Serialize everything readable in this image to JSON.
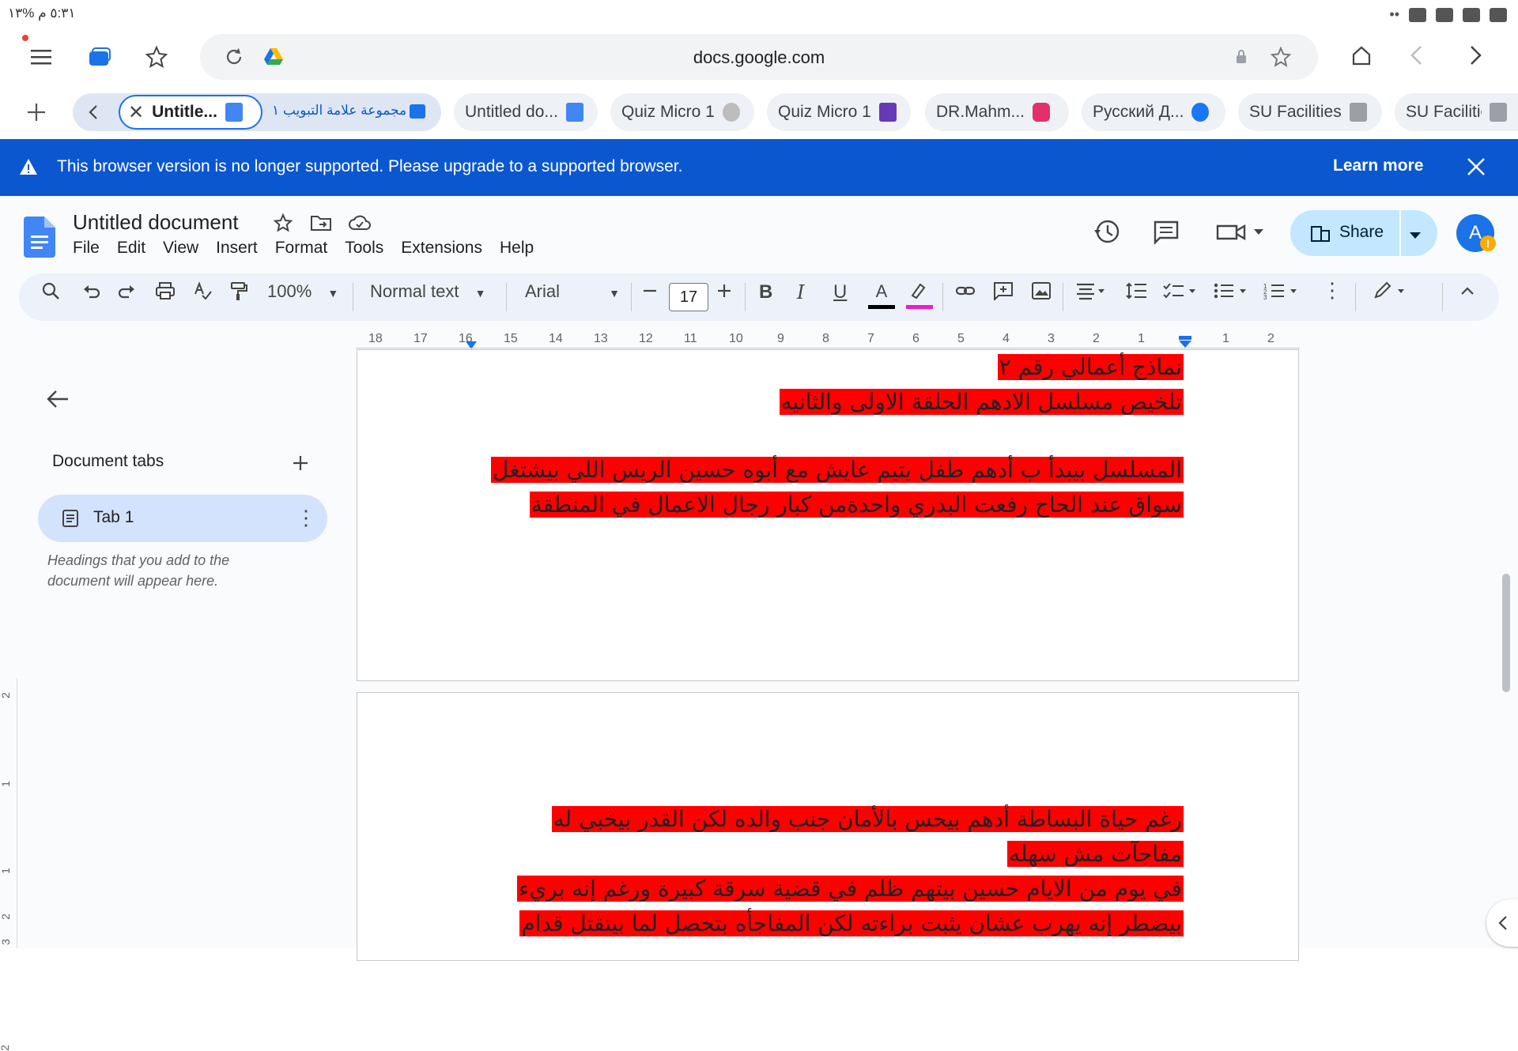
{
  "status_bar": {
    "time_battery": "٥:٣١ م  %١٣"
  },
  "browser": {
    "url": "docs.google.com",
    "tabs": [
      {
        "label": "Untitle...",
        "active": true
      },
      {
        "label": "مجموعة علامة التبويب ١"
      },
      {
        "label": "Untitled do..."
      },
      {
        "label": "Quiz Micro 1"
      },
      {
        "label": "Quiz Micro 1"
      },
      {
        "label": "DR.Mahm..."
      },
      {
        "label": "Русский Д..."
      },
      {
        "label": "SU Facilities"
      },
      {
        "label": "SU Facilities"
      }
    ]
  },
  "banner": {
    "message": "This browser version is no longer supported. Please upgrade to a supported browser.",
    "learn_more": "Learn more"
  },
  "doc": {
    "title": "Untitled document",
    "menu": [
      "File",
      "Edit",
      "View",
      "Insert",
      "Format",
      "Tools",
      "Extensions",
      "Help"
    ],
    "share_label": "Share",
    "avatar_letter": "A"
  },
  "toolbar": {
    "zoom": "100%",
    "style": "Normal text",
    "font": "Arial",
    "font_size": "17",
    "text_color": "#000000",
    "highlight_color": "#e91ec7"
  },
  "ruler": {
    "ticks": [
      "18",
      "17",
      "16",
      "15",
      "14",
      "13",
      "12",
      "11",
      "10",
      "9",
      "8",
      "7",
      "6",
      "5",
      "4",
      "3",
      "2",
      "1",
      "1",
      "2"
    ]
  },
  "left_ruler": {
    "ticks": [
      "2",
      "1",
      "1",
      "2",
      "3"
    ]
  },
  "sidebar": {
    "heading": "Document tabs",
    "tab_label": "Tab 1",
    "hint": "Headings that you add to the document will appear here."
  },
  "page1": {
    "lines": [
      "نماذج أعمالي رقم ٢",
      "تلخيص مسلسل الادهم الحلقة الاولى والثانيه",
      "",
      "المسلسل بيبدأ ب أدهم طفل يتيم عايش مع أبوه حسين الريس اللي بيشتغل",
      "سواق عند الحاج رفعت البدري واحدةمن كبار رجال الاعمال في المنطقة"
    ]
  },
  "page2": {
    "lines": [
      "رغم حياة البساطة أدهم بيحس بالأمان جنب والده لكن القدر بيخبي له",
      "مفاجآت مش سهله",
      "في يوم من الايام حسين بيتهم ظلم في قضية سرقة كبيرة ورغم إنه بريء",
      "بيضطر إنه يهرب عشان يثبت براءته لكن المفاجأه بتحصل لما بيتقتل قدام"
    ]
  },
  "colors": {
    "highlight": "#ff0000",
    "banner": "#0b57d0",
    "share": "#c2e7ff"
  }
}
